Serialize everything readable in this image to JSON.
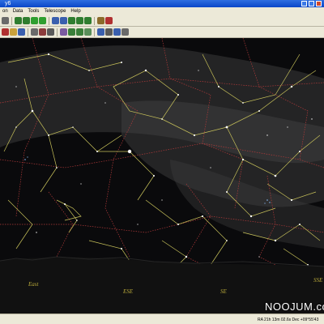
{
  "window": {
    "title": "y6"
  },
  "menu": [
    "on",
    "Data",
    "Tools",
    "Telescope",
    "Help"
  ],
  "toolbar1": [
    {
      "icon": "print-icon",
      "color": "#6a6a6a"
    },
    {
      "icon": "arrow-up-icon",
      "color": "#2f7d2f"
    },
    {
      "icon": "arrow-down-icon",
      "color": "#2f7d2f"
    },
    {
      "icon": "arrow-left-icon",
      "color": "#2f9f2f"
    },
    {
      "icon": "arrow-right-icon",
      "color": "#2f9f2f"
    },
    {
      "icon": "zoom-in-icon",
      "color": "#3a5fae"
    },
    {
      "icon": "zoom-out-icon",
      "color": "#3a5fae"
    },
    {
      "icon": "rotate-left-icon",
      "color": "#2f7d2f"
    },
    {
      "icon": "rotate-right-icon",
      "color": "#2f7d2f"
    },
    {
      "icon": "refresh-icon",
      "color": "#2f7d2f"
    },
    {
      "icon": "find-icon",
      "color": "#8a6b2a"
    },
    {
      "icon": "stop-icon",
      "color": "#b03030"
    }
  ],
  "toolbar2": [
    {
      "icon": "zoom-box-icon",
      "color": "#b03030"
    },
    {
      "icon": "folder-open-icon",
      "color": "#c9a13b"
    },
    {
      "icon": "save-icon",
      "color": "#3a5fae"
    },
    {
      "icon": "telescope-icon",
      "color": "#6a6a6a"
    },
    {
      "icon": "eyepiece-icon",
      "color": "#8c3c3c"
    },
    {
      "icon": "camera-icon",
      "color": "#5a5a5a"
    },
    {
      "icon": "moon-icon",
      "color": "#7a5aa0"
    },
    {
      "icon": "planet-icon",
      "color": "#3a7f3a"
    },
    {
      "icon": "comet-icon",
      "color": "#3a7f3a"
    },
    {
      "icon": "galaxy-icon",
      "color": "#5a8f5a"
    },
    {
      "icon": "grid-icon",
      "color": "#3a5fae"
    },
    {
      "icon": "horizon-icon",
      "color": "#5a5a5a"
    },
    {
      "icon": "eye-icon",
      "color": "#3a5fae"
    },
    {
      "icon": "settings-icon",
      "color": "#6a6a6a"
    }
  ],
  "horizon_labels": [
    "East",
    "ESE",
    "SE",
    "SSE"
  ],
  "status": {
    "coordinates": "RA 21h 13m 02.6s   Dec +09°55'43"
  },
  "watermark": "NOOJUM.com",
  "colors": {
    "constellation_lines": "#c8c25a",
    "boundaries": "#b23a3a",
    "milky_way": "#4a4a4a",
    "background": "#0a0a0c"
  }
}
